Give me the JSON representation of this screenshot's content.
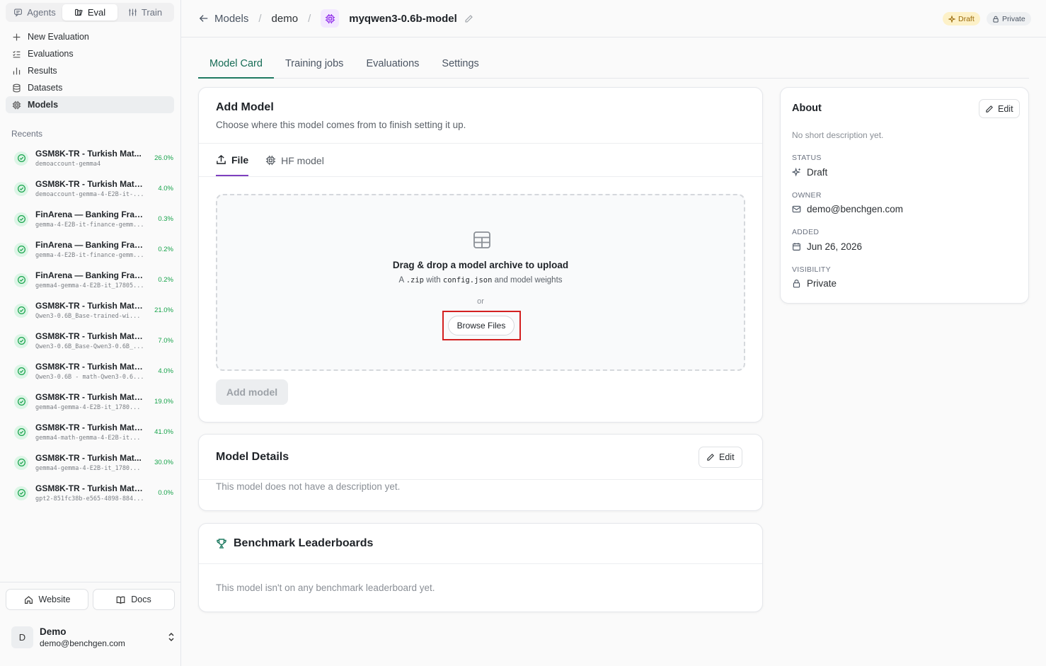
{
  "sidebar": {
    "segments": [
      {
        "label": "Agents",
        "icon": "chat-icon"
      },
      {
        "label": "Eval",
        "icon": "flask-icon",
        "active": true
      },
      {
        "label": "Train",
        "icon": "sliders-icon"
      }
    ],
    "nav": [
      {
        "label": "New Evaluation",
        "icon": "plus-icon"
      },
      {
        "label": "Evaluations",
        "icon": "list-checks-icon"
      },
      {
        "label": "Results",
        "icon": "bar-chart-icon"
      },
      {
        "label": "Datasets",
        "icon": "database-icon"
      },
      {
        "label": "Models",
        "icon": "chip-icon",
        "active": true
      }
    ],
    "recents_title": "Recents",
    "recents": [
      {
        "title": "GSM8K-TR - Turkish Mat...",
        "sub": "demoaccount-gemma4",
        "score": "26.0%"
      },
      {
        "title": "GSM8K-TR - Turkish Math ...",
        "sub": "demoaccount-gemma-4-E2B-it-...",
        "score": "4.0%"
      },
      {
        "title": "FinArena — Banking Fraud...",
        "sub": "gemma-4-E2B-it-finance-gemm...",
        "score": "0.3%"
      },
      {
        "title": "FinArena — Banking Fraud...",
        "sub": "gemma-4-E2B-it-finance-gemm...",
        "score": "0.2%"
      },
      {
        "title": "FinArena — Banking Fraud...",
        "sub": "gemma4-gemma-4-E2B-it_17805...",
        "score": "0.2%"
      },
      {
        "title": "GSM8K-TR - Turkish Math...",
        "sub": "Qwen3-0.6B_Base-trained-wi...",
        "score": "21.0%"
      },
      {
        "title": "GSM8K-TR - Turkish Math ...",
        "sub": "Qwen3-0.6B_Base-Qwen3-0.6B_...",
        "score": "7.0%"
      },
      {
        "title": "GSM8K-TR - Turkish Math ...",
        "sub": "Qwen3-0.6B - math-Qwen3-0.6...",
        "score": "4.0%"
      },
      {
        "title": "GSM8K-TR - Turkish Math...",
        "sub": "gemma4-gemma-4-E2B-it_1780...",
        "score": "19.0%"
      },
      {
        "title": "GSM8K-TR - Turkish Math...",
        "sub": "gemma4-math-gemma-4-E2B-it...",
        "score": "41.0%"
      },
      {
        "title": "GSM8K-TR - Turkish Mat...",
        "sub": "gemma4-gemma-4-E2B-it_1780...",
        "score": "30.0%"
      },
      {
        "title": "GSM8K-TR - Turkish Math ...",
        "sub": "gpt2-851fc38b-e565-4898-884...",
        "score": "0.0%"
      }
    ],
    "website_label": "Website",
    "docs_label": "Docs",
    "user": {
      "initial": "D",
      "name": "Demo",
      "email": "demo@benchgen.com"
    }
  },
  "header": {
    "back_label": "Models",
    "project": "demo",
    "model_name": "myqwen3-0.6b-model",
    "draft_label": "Draft",
    "private_label": "Private"
  },
  "tabs": [
    "Model Card",
    "Training jobs",
    "Evaluations",
    "Settings"
  ],
  "add_model": {
    "title": "Add Model",
    "subtitle": "Choose where this model comes from to finish setting it up.",
    "source_tabs": [
      "File",
      "HF model"
    ],
    "drop_title": "Drag & drop a model archive to upload",
    "drop_sub_a": "A",
    "drop_sub_zip": ".zip",
    "drop_sub_b": "with",
    "drop_sub_config": "config.json",
    "drop_sub_c": "and model weights",
    "or_label": "or",
    "browse_label": "Browse Files",
    "add_button": "Add model"
  },
  "model_details": {
    "title": "Model Details",
    "edit_label": "Edit",
    "text": "This model does not have a description yet."
  },
  "benchmark": {
    "title": "Benchmark Leaderboards",
    "text": "This model isn't on any benchmark leaderboard yet."
  },
  "about": {
    "title": "About",
    "edit_label": "Edit",
    "desc": "No short description yet.",
    "status_label": "STATUS",
    "status": "Draft",
    "owner_label": "OWNER",
    "owner": "demo@benchgen.com",
    "added_label": "ADDED",
    "added": "Jun 26, 2026",
    "visibility_label": "VISIBILITY",
    "visibility": "Private"
  },
  "colors": {
    "accent_green": "#1f7a61",
    "accent_purple": "#7e3fbf",
    "success": "#16a34a",
    "highlight_red": "#d32020",
    "draft_bg": "#fdf1c8"
  }
}
